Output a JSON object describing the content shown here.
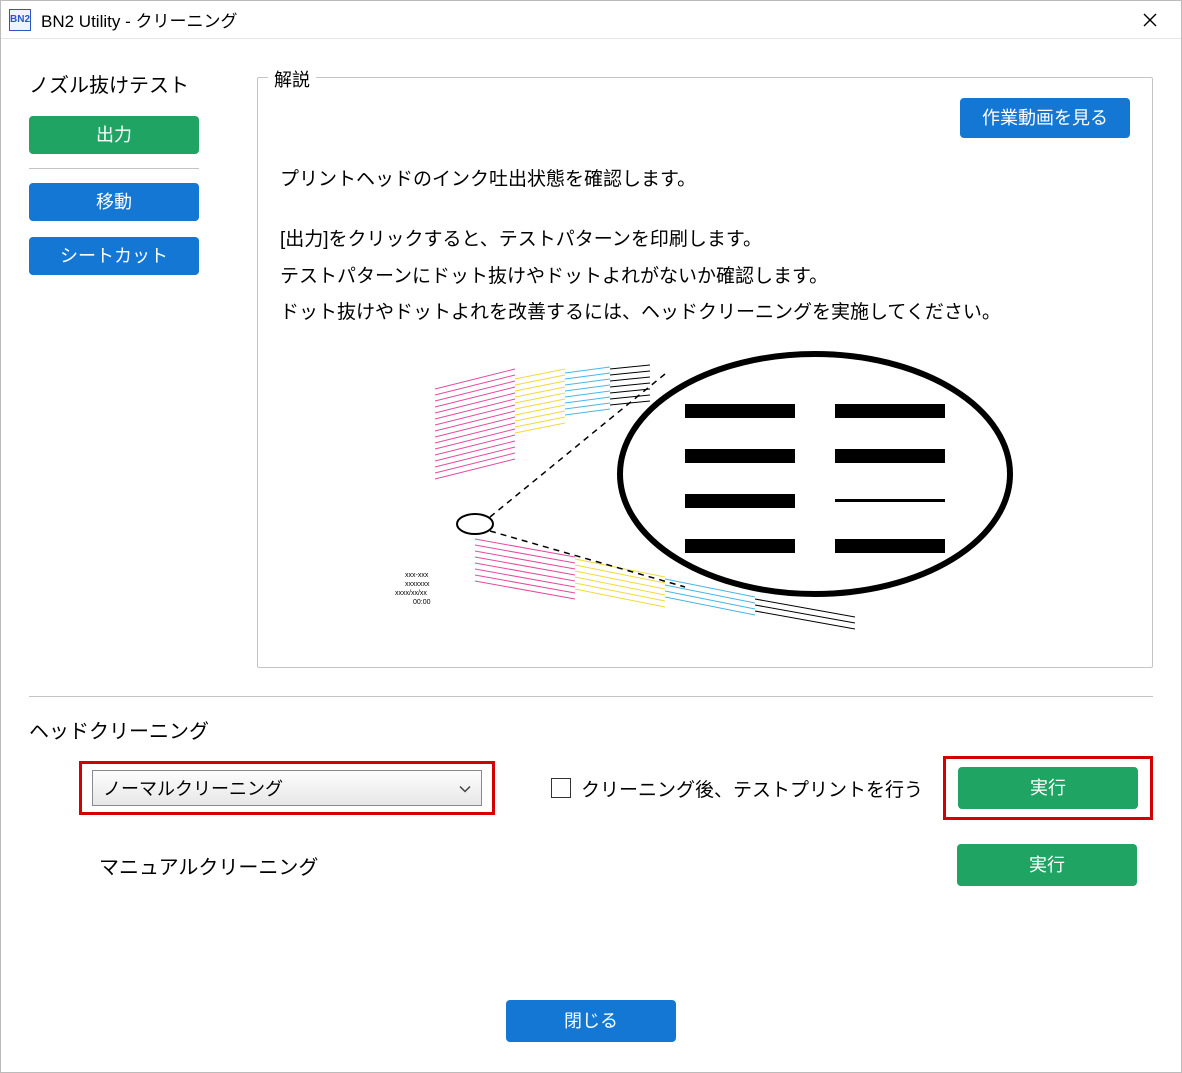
{
  "window": {
    "app_icon_text": "BN2",
    "title": "BN2 Utility - クリーニング"
  },
  "nozzle_test": {
    "title": "ノズル抜けテスト",
    "output_button": "出力",
    "move_button": "移動",
    "sheet_cut_button": "シートカット"
  },
  "explanation": {
    "legend": "解説",
    "video_button": "作業動画を見る",
    "line1": "プリントヘッドのインク吐出状態を確認します。",
    "line2": "[出力]をクリックすると、テストパターンを印刷します。",
    "line3": "テストパターンにドット抜けやドットよれがないか確認します。",
    "line4": "ドット抜けやドットよれを改善するには、ヘッドクリーニングを実施してください。"
  },
  "head_cleaning": {
    "label": "ヘッドクリーニング",
    "dropdown_selected": "ノーマルクリーニング",
    "checkbox_label": "クリーニング後、テストプリントを行う",
    "checkbox_checked": false,
    "execute_button": "実行",
    "manual_label": "マニュアルクリーニング",
    "manual_execute_button": "実行"
  },
  "footer": {
    "close_button": "閉じる"
  }
}
